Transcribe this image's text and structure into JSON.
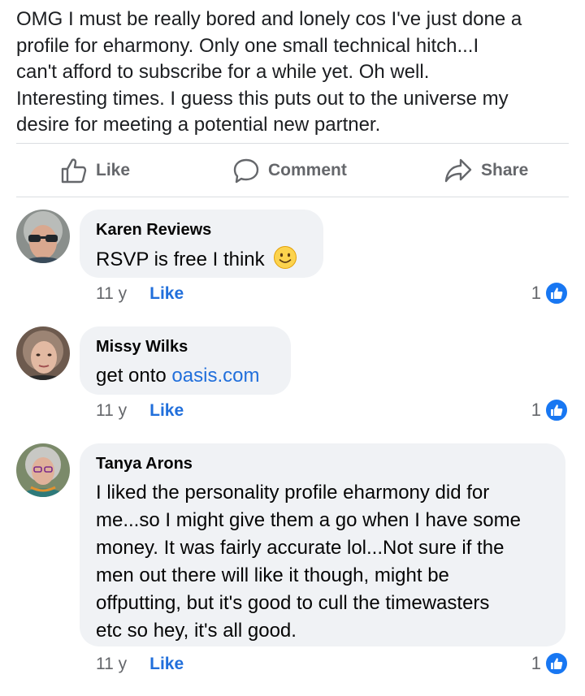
{
  "post": {
    "lines": [
      "OMG  I must be really bored and lonely cos I've just done a",
      "profile for eharmony.  Only one small technical hitch...I",
      "can't afford to subscribe for a while yet.  Oh well.",
      "Interesting times.  I guess this puts out to the universe my",
      "desire for meeting a potential  new partner."
    ]
  },
  "actions": {
    "like": "Like",
    "comment": "Comment",
    "share": "Share"
  },
  "comments": [
    {
      "author": "Karen Reviews",
      "text": "RSVP is free I think",
      "emoji": "slightly-smiling-face",
      "time": "11 y",
      "like_label": "Like",
      "reaction_count": "1"
    },
    {
      "author": "Missy Wilks",
      "text_prefix": "get onto ",
      "link": "oasis.com",
      "time": "11 y",
      "like_label": "Like",
      "reaction_count": "1"
    },
    {
      "author": "Tanya Arons",
      "lines": [
        "I liked the personality profile  eharmony did for",
        "me...so I might give them a go when I have some",
        "money.  It was fairly accurate lol...Not sure if the",
        "men out there will like it though, might be",
        "offputting, but it's good to cull the timewasters",
        "etc so hey, it's all good."
      ],
      "time": "11 y",
      "like_label": "Like",
      "reaction_count": "1"
    }
  ],
  "colors": {
    "link": "#216fdb",
    "bubble": "#f0f2f5",
    "muted": "#65676b",
    "like_reaction": "#1877f2"
  },
  "icons": {
    "like": "thumbs-up-icon",
    "comment": "speech-bubble-icon",
    "share": "share-arrow-icon",
    "reaction": "like-reaction-icon"
  }
}
